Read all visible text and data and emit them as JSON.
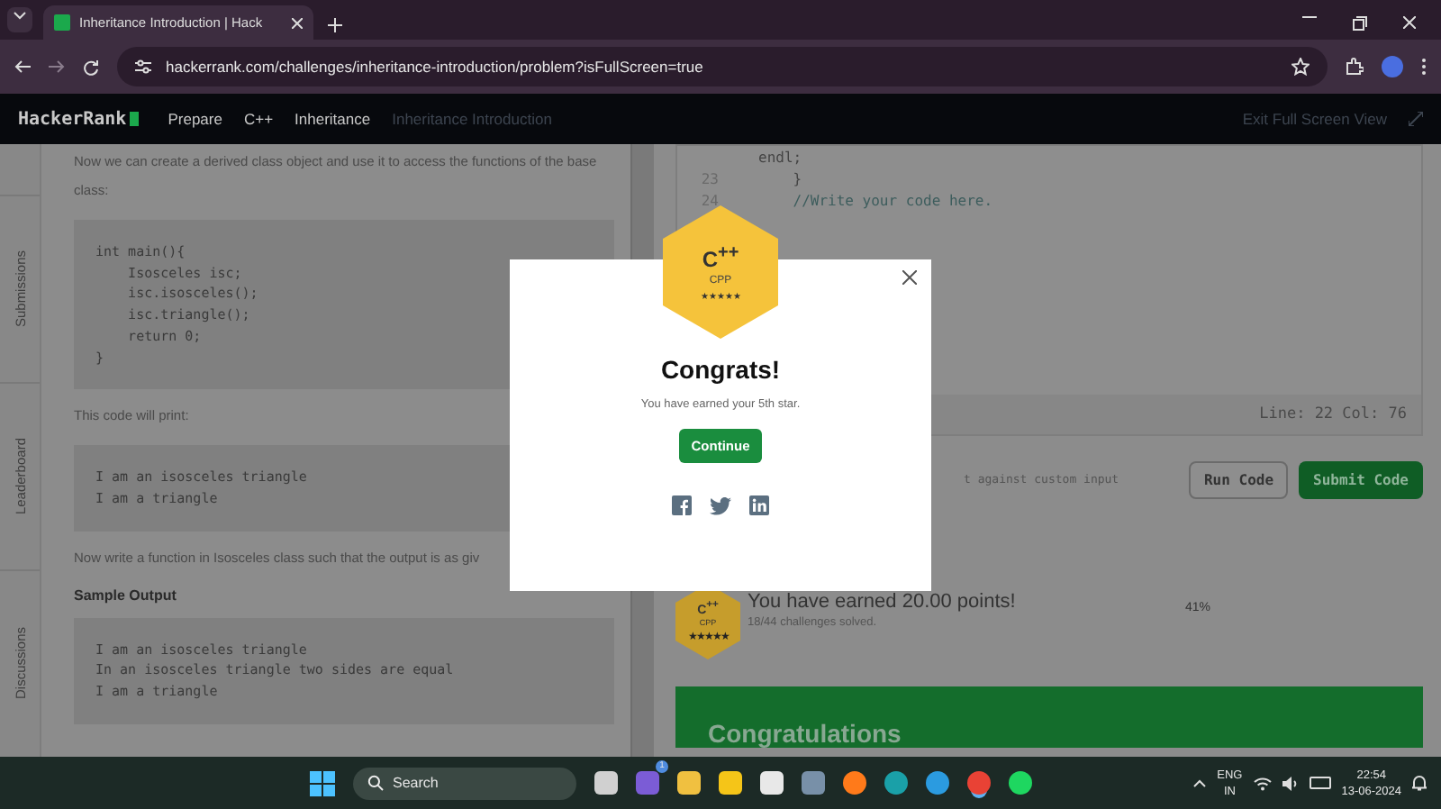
{
  "browser": {
    "tab_title": "Inheritance Introduction | Hack",
    "url": "hackerrank.com/challenges/inheritance-introduction/problem?isFullScreen=true"
  },
  "nav": {
    "logo": "HackerRank",
    "breadcrumbs": [
      {
        "label": "Prepare",
        "selected": false
      },
      {
        "label": "C++",
        "selected": false
      },
      {
        "label": "Inheritance",
        "selected": false
      },
      {
        "label": "Inheritance Introduction",
        "selected": true
      }
    ],
    "exit": "Exit Full Screen View"
  },
  "side_tabs": [
    "Submissions",
    "Leaderboard",
    "Discussions"
  ],
  "problem": [
    {
      "kind": "text",
      "text": "Now we can create a derived class object and use it to access the functions of the base class:"
    },
    {
      "kind": "code",
      "lines": [
        "int main(){",
        "    Isosceles isc;",
        "    isc.isosceles();",
        "    isc.triangle();",
        "    return 0;",
        "}"
      ]
    },
    {
      "kind": "text",
      "text": "This code will print:"
    },
    {
      "kind": "code",
      "lines": [
        "I am an isosceles triangle",
        "I am a triangle"
      ]
    },
    {
      "kind": "text",
      "text": "Now write a function in Isosceles class such that the output is as giv"
    },
    {
      "kind": "heading",
      "text": "Sample Output"
    },
    {
      "kind": "code",
      "lines": [
        "I am an isosceles triangle",
        "In an isosceles triangle two sides are equal",
        "I am a triangle"
      ]
    }
  ],
  "editor": {
    "lines": [
      {
        "code": "endl;"
      },
      {
        "number": "23",
        "code": "    }"
      },
      {
        "number": "24",
        "code": "    //Write your code here."
      }
    ],
    "status": "Line: 22 Col: 76"
  },
  "test_hint": "t against custom input",
  "buttons": [
    {
      "label": "Run Code",
      "kind": "secondary"
    },
    {
      "label": "Submit Code",
      "kind": "primary"
    }
  ],
  "result": {
    "badge": {
      "logo": "C$^{++}$",
      "name": "CPP",
      "stars": 5
    },
    "headline": "You have earned 20.00 points!",
    "progress_text": "18/44 challenges solved.",
    "percent": "41%"
  },
  "banner": "Congratulations",
  "modal": {
    "badge": {
      "logo": "C$^{++}$",
      "name": "CPP",
      "stars": 5
    },
    "title": "Congrats!",
    "message": "You have earned your 5th star.",
    "button": "Continue"
  },
  "taskbar": {
    "search_placeholder": "Search",
    "teams_badge": "1",
    "lang": "ENG",
    "region": "IN",
    "time": "22:54",
    "date": "13-06-2024"
  }
}
